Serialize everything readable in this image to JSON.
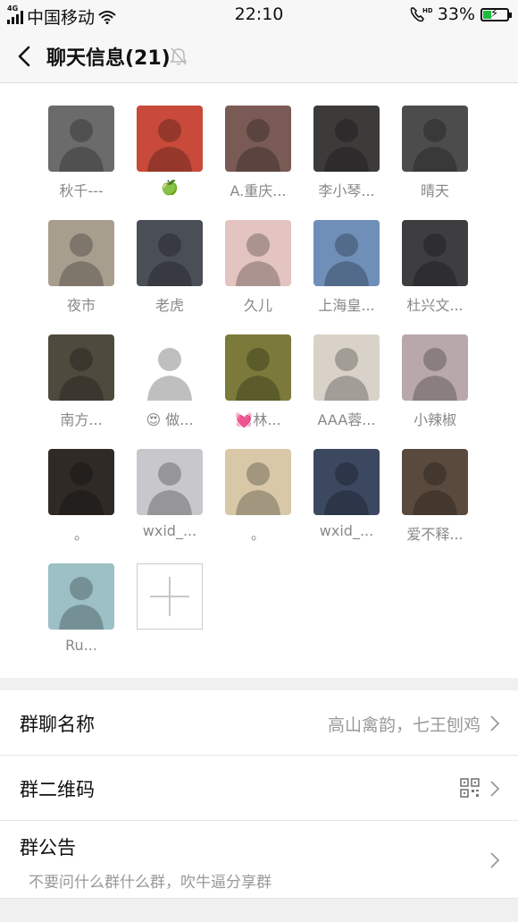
{
  "status_bar": {
    "network_tag": "4G",
    "carrier": "中国移动",
    "time": "22:10",
    "hd_tag": "HD",
    "battery": "33%",
    "battery_level": 0.33
  },
  "nav": {
    "title": "聊天信息(21)",
    "back_icon": "chevron-left-icon",
    "mute_icon": "bell-off-icon"
  },
  "members": [
    {
      "name": "秋千---",
      "avatar_color": "#6b6b6b"
    },
    {
      "name": "🍏",
      "avatar_color": "#c94a3a"
    },
    {
      "name": "A.重庆...",
      "avatar_color": "#7a5a55"
    },
    {
      "name": "李小琴...",
      "avatar_color": "#3d3a3a"
    },
    {
      "name": "晴天",
      "avatar_color": "#4c4c4c"
    },
    {
      "name": "夜市",
      "avatar_color": "#a89e8e"
    },
    {
      "name": "老虎",
      "avatar_color": "#4a4e56"
    },
    {
      "name": "久儿",
      "avatar_color": "#e4c4c0"
    },
    {
      "name": "上海皇...",
      "avatar_color": "#6f8fb8"
    },
    {
      "name": "杜兴文...",
      "avatar_color": "#3e3e40"
    },
    {
      "name": "南方...",
      "avatar_color": "#4f4a3e"
    },
    {
      "name": "😍 做...",
      "avatar_color": "#ffffff"
    },
    {
      "name": "💓林...",
      "avatar_color": "#7b7a3a"
    },
    {
      "name": "AAA蓉...",
      "avatar_color": "#d9d2c8"
    },
    {
      "name": "小辣椒",
      "avatar_color": "#b8a8ac"
    },
    {
      "name": "。",
      "avatar_color": "#2f2a26"
    },
    {
      "name": "wxid_...",
      "avatar_color": "#c8c8cc"
    },
    {
      "name": "。",
      "avatar_color": "#d8c8a8"
    },
    {
      "name": "wxid_...",
      "avatar_color": "#3b4860"
    },
    {
      "name": "爱不释...",
      "avatar_color": "#5a4a3e"
    },
    {
      "name": "Ru...",
      "avatar_color": "#9cc0c6"
    }
  ],
  "add_member_icon": "plus-icon",
  "settings": {
    "group_name_label": "群聊名称",
    "group_name_value": "高山禽韵，七王刨鸡",
    "qr_label": "群二维码",
    "qr_icon": "qr-code-icon",
    "notice_label": "群公告",
    "notice_text": "不要问什么群什么群，吹牛逼分享群"
  }
}
